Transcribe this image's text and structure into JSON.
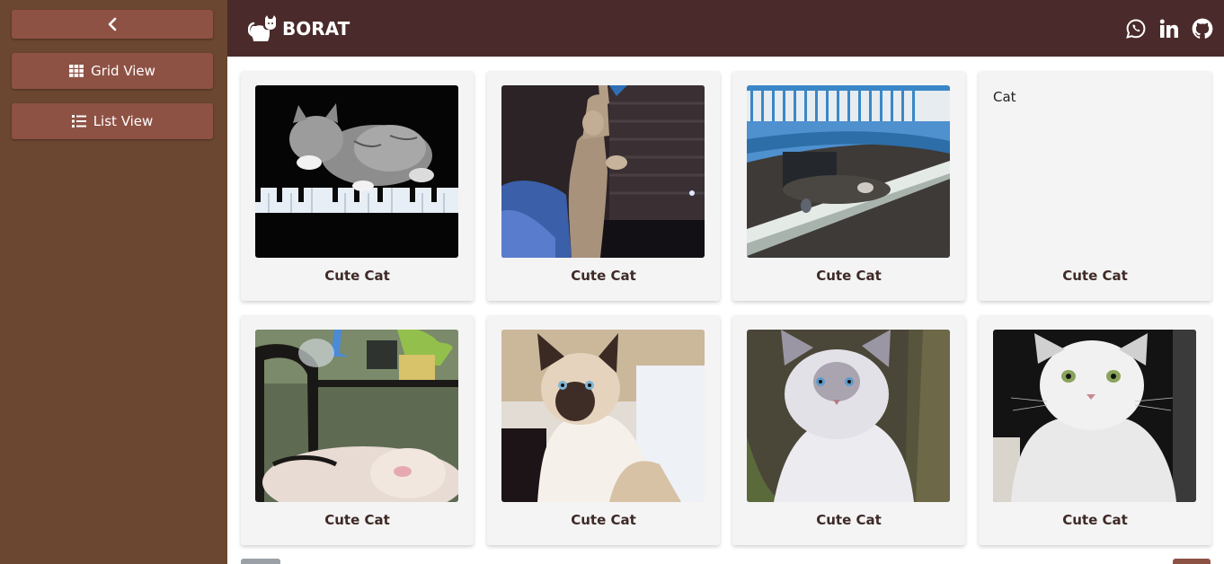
{
  "sidebar": {
    "collapse_icon": "chevron-left-icon",
    "buttons": [
      {
        "label": "Grid View",
        "icon": "grid-icon"
      },
      {
        "label": "List View",
        "icon": "list-icon"
      }
    ]
  },
  "header": {
    "brand": "BORAT",
    "logo_icon": "cat-icon",
    "social": [
      "whatsapp-icon",
      "linkedin-icon",
      "github-icon"
    ]
  },
  "gallery": {
    "cards": [
      {
        "caption": "Cute Cat",
        "image": "kitten-on-piano"
      },
      {
        "caption": "Cute Cat",
        "image": "cat-standing-up"
      },
      {
        "caption": "Cute Cat",
        "image": "cat-on-pipe-under-bridge"
      },
      {
        "caption": "Cute Cat",
        "alt_text": "Cat"
      },
      {
        "caption": "Cute Cat",
        "image": "cat-sleeping-on-chair"
      },
      {
        "caption": "Cute Cat",
        "image": "siamese-kitten"
      },
      {
        "caption": "Cute Cat",
        "image": "fluffy-blue-eyed-cat"
      },
      {
        "caption": "Cute Cat",
        "image": "white-persian-cat"
      }
    ]
  },
  "colors": {
    "sidebar_bg": "#6b4630",
    "sidebar_button": "#8e5244",
    "header_bg": "#4a2a2a",
    "card_bg": "#f4f4f4",
    "caption_text": "#3e2a26"
  }
}
